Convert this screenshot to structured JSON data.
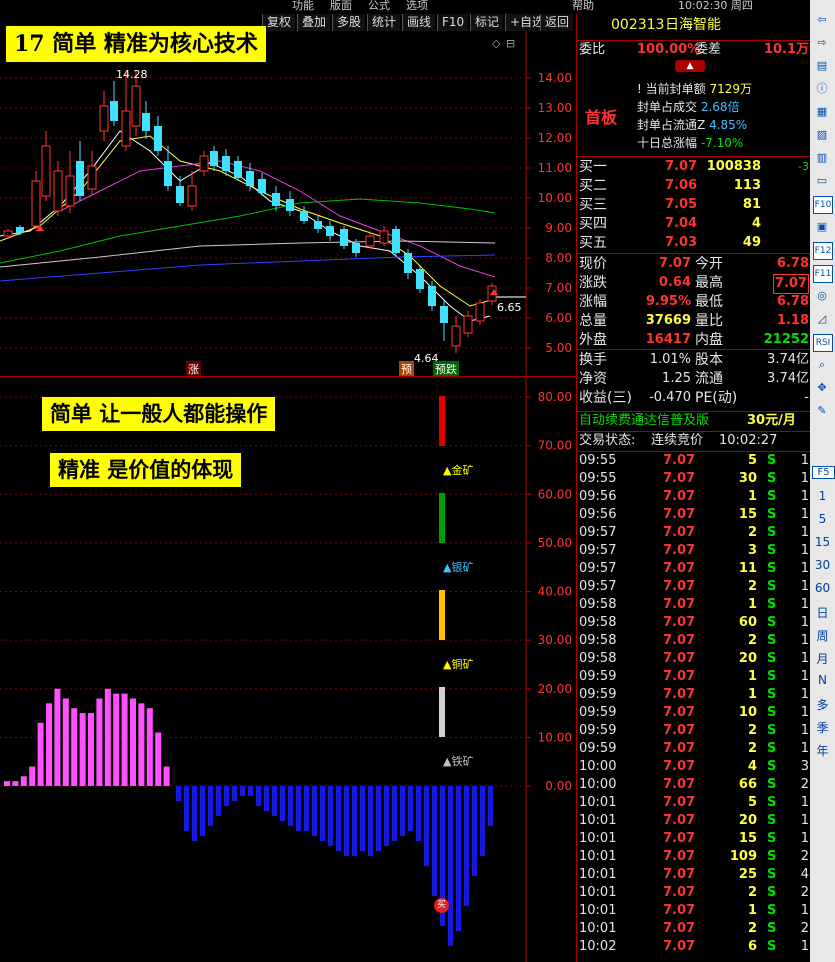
{
  "toolbar": {
    "top_menu": [
      "功能",
      "版面",
      "公式",
      "选项",
      "帮助"
    ],
    "time_status": "10:02:30 周四",
    "buttons": [
      "复权",
      "叠加",
      "多股",
      "统计",
      "画线",
      "F10",
      "标记",
      "+自选",
      "返回"
    ]
  },
  "banners": {
    "main": "17    简单    精准为核心技术",
    "line1": "简单  让一般人都能操作",
    "line2": "精准       是价值的体现"
  },
  "kline": {
    "y_ticks": [
      "14.00",
      "13.00",
      "12.00",
      "11.00",
      "10.00",
      "9.00",
      "8.00",
      "7.00",
      "6.00",
      "5.00"
    ],
    "high_label": "14.28",
    "low_label": "4.64",
    "last_label": "6.65",
    "markers": [
      "涨",
      "预",
      "预跌"
    ]
  },
  "indicator": {
    "y_ticks": [
      "80.00",
      "70.00",
      "60.00",
      "50.00",
      "40.00",
      "30.00",
      "20.00",
      "10.00",
      "0.00"
    ],
    "legend": [
      {
        "label": "金矿",
        "color": "#ffff00"
      },
      {
        "label": "银矿",
        "color": "#40c0ff"
      },
      {
        "label": "铜矿",
        "color": "#ffff00"
      },
      {
        "label": "铁矿",
        "color": "#c0c0c0"
      }
    ],
    "bar_colors": {
      "gold": "#e00000",
      "silver": "#00a000",
      "copper": "#ffc000",
      "iron": "#d0d0d0"
    },
    "buy_marker": "买"
  },
  "quote": {
    "code": "002313",
    "name": "日海智能",
    "weibi_label": "委比",
    "weibi_value": "100.00%",
    "weicha_label": "委差",
    "weicha_value": "10.1万",
    "board": "首板",
    "seal_info": [
      {
        "label": "当前封单额",
        "value": "7129万",
        "color": "#ffff40"
      },
      {
        "label": "封单占成交",
        "value": "2.68倍",
        "color": "#40c0ff"
      },
      {
        "label": "封单占流通Z",
        "value": "4.85%",
        "color": "#40c0ff"
      },
      {
        "label": "十日总涨幅",
        "value": "-7.10%",
        "color": "#00e000"
      }
    ],
    "bids": [
      {
        "label": "买一",
        "price": "7.07",
        "vol": "100838",
        "chg": "-3"
      },
      {
        "label": "买二",
        "price": "7.06",
        "vol": "113",
        "chg": ""
      },
      {
        "label": "买三",
        "price": "7.05",
        "vol": "81",
        "chg": ""
      },
      {
        "label": "买四",
        "price": "7.04",
        "vol": "4",
        "chg": ""
      },
      {
        "label": "买五",
        "price": "7.03",
        "vol": "49",
        "chg": ""
      }
    ],
    "stats": [
      {
        "l1": "现价",
        "v1": "7.07",
        "c1": "#ff3232",
        "l2": "今开",
        "v2": "6.78",
        "c2": "#ff3232"
      },
      {
        "l1": "涨跌",
        "v1": "0.64",
        "c1": "#ff3232",
        "l2": "最高",
        "v2": "7.07",
        "c2": "#ff3232"
      },
      {
        "l1": "涨幅",
        "v1": "9.95%",
        "c1": "#ff3232",
        "l2": "最低",
        "v2": "6.78",
        "c2": "#ff3232"
      },
      {
        "l1": "总量",
        "v1": "37669",
        "c1": "#ffff40",
        "l2": "量比",
        "v2": "1.18",
        "c2": "#ff3232"
      },
      {
        "l1": "外盘",
        "v1": "16417",
        "c1": "#ff3232",
        "l2": "内盘",
        "v2": "21252",
        "c2": "#00e000"
      }
    ],
    "stats2": [
      {
        "l1": "换手",
        "v1": "1.01%",
        "l2": "股本",
        "v2": "3.74亿"
      },
      {
        "l1": "净资",
        "v1": "1.25",
        "l2": "流通",
        "v2": "3.74亿"
      },
      {
        "l1": "收益(三)",
        "v1": "-0.470",
        "l2": "PE(动)",
        "v2": "-"
      }
    ],
    "ad_text": "自动续费通达信普及版",
    "ad_price": "30元/月",
    "status_label": "交易状态:",
    "status_value": "连续竞价",
    "status_time": "10:02:27"
  },
  "ticks": [
    {
      "t": "09:55",
      "p": "7.07",
      "v": "5",
      "s": "S",
      "n": "1"
    },
    {
      "t": "09:55",
      "p": "7.07",
      "v": "30",
      "s": "S",
      "n": "1"
    },
    {
      "t": "09:56",
      "p": "7.07",
      "v": "1",
      "s": "S",
      "n": "1"
    },
    {
      "t": "09:56",
      "p": "7.07",
      "v": "15",
      "s": "S",
      "n": "1"
    },
    {
      "t": "09:57",
      "p": "7.07",
      "v": "2",
      "s": "S",
      "n": "1"
    },
    {
      "t": "09:57",
      "p": "7.07",
      "v": "3",
      "s": "S",
      "n": "1"
    },
    {
      "t": "09:57",
      "p": "7.07",
      "v": "11",
      "s": "S",
      "n": "1"
    },
    {
      "t": "09:57",
      "p": "7.07",
      "v": "2",
      "s": "S",
      "n": "1"
    },
    {
      "t": "09:58",
      "p": "7.07",
      "v": "1",
      "s": "S",
      "n": "1"
    },
    {
      "t": "09:58",
      "p": "7.07",
      "v": "60",
      "s": "S",
      "n": "1"
    },
    {
      "t": "09:58",
      "p": "7.07",
      "v": "2",
      "s": "S",
      "n": "1"
    },
    {
      "t": "09:58",
      "p": "7.07",
      "v": "20",
      "s": "S",
      "n": "1"
    },
    {
      "t": "09:59",
      "p": "7.07",
      "v": "1",
      "s": "S",
      "n": "1"
    },
    {
      "t": "09:59",
      "p": "7.07",
      "v": "1",
      "s": "S",
      "n": "1"
    },
    {
      "t": "09:59",
      "p": "7.07",
      "v": "10",
      "s": "S",
      "n": "1"
    },
    {
      "t": "09:59",
      "p": "7.07",
      "v": "2",
      "s": "S",
      "n": "1"
    },
    {
      "t": "09:59",
      "p": "7.07",
      "v": "2",
      "s": "S",
      "n": "1"
    },
    {
      "t": "10:00",
      "p": "7.07",
      "v": "4",
      "s": "S",
      "n": "3"
    },
    {
      "t": "10:00",
      "p": "7.07",
      "v": "66",
      "s": "S",
      "n": "2"
    },
    {
      "t": "10:01",
      "p": "7.07",
      "v": "5",
      "s": "S",
      "n": "1"
    },
    {
      "t": "10:01",
      "p": "7.07",
      "v": "20",
      "s": "S",
      "n": "1"
    },
    {
      "t": "10:01",
      "p": "7.07",
      "v": "15",
      "s": "S",
      "n": "1"
    },
    {
      "t": "10:01",
      "p": "7.07",
      "v": "109",
      "s": "S",
      "n": "2"
    },
    {
      "t": "10:01",
      "p": "7.07",
      "v": "25",
      "s": "S",
      "n": "4"
    },
    {
      "t": "10:01",
      "p": "7.07",
      "v": "2",
      "s": "S",
      "n": "2"
    },
    {
      "t": "10:01",
      "p": "7.07",
      "v": "1",
      "s": "S",
      "n": "1"
    },
    {
      "t": "10:01",
      "p": "7.07",
      "v": "2",
      "s": "S",
      "n": "2"
    },
    {
      "t": "10:02",
      "p": "7.07",
      "v": "6",
      "s": "S",
      "n": "1"
    }
  ],
  "side_tools": [
    "F5",
    "1",
    "5",
    "15",
    "30",
    "60",
    "日",
    "周",
    "月",
    "N",
    "多",
    "季",
    "年"
  ],
  "side_icons": [
    "back-icon",
    "forward-icon",
    "ruler-icon",
    "info-icon",
    "grid-icon",
    "chart-icon",
    "candle-icon",
    "page-icon",
    "F10",
    "doc-icon",
    "F12",
    "F11",
    "target-icon",
    "trend-icon",
    "RSI",
    "zoom-icon",
    "move-icon",
    "pen-icon"
  ]
}
